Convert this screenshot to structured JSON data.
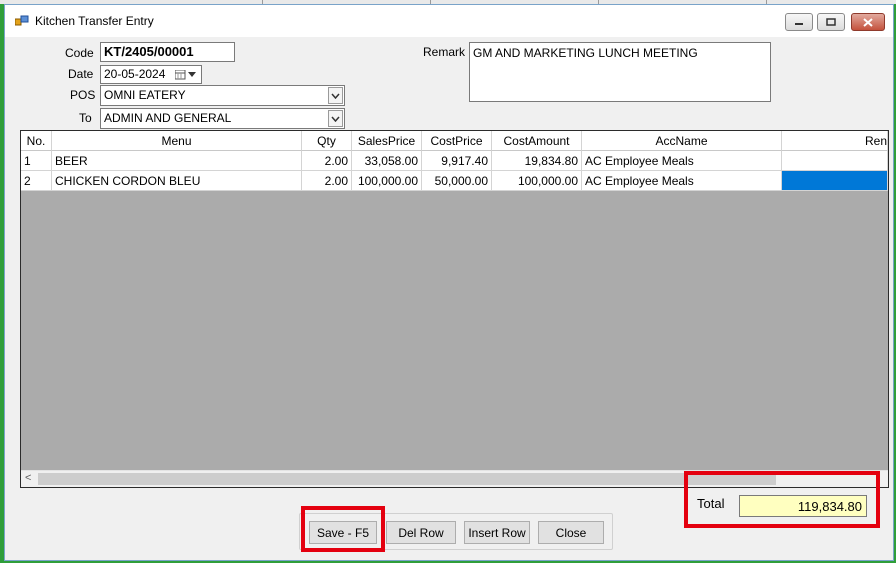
{
  "window": {
    "title": "Kitchen Transfer Entry"
  },
  "form": {
    "code_label": "Code",
    "code_value": "KT/2405/00001",
    "date_label": "Date",
    "date_value": "20-05-2024",
    "pos_label": "POS",
    "pos_value": "OMNI EATERY",
    "to_label": "To",
    "to_value": "ADMIN AND GENERAL",
    "remark_label": "Remark",
    "remark_value": "GM AND MARKETING LUNCH MEETING"
  },
  "grid": {
    "columns": [
      "No.",
      "Menu",
      "Qty",
      "SalesPrice",
      "CostPrice",
      "CostAmount",
      "AccName",
      "Ren"
    ],
    "rows": [
      {
        "no": "1",
        "menu": "BEER",
        "qty": "2.00",
        "sales_price": "33,058.00",
        "cost_price": "9,917.40",
        "cost_amount": "19,834.80",
        "acc_name": "AC Employee Meals",
        "ren": ""
      },
      {
        "no": "2",
        "menu": "CHICKEN CORDON BLEU",
        "qty": "2.00",
        "sales_price": "100,000.00",
        "cost_price": "50,000.00",
        "cost_amount": "100,000.00",
        "acc_name": "AC Employee Meals",
        "ren": ""
      }
    ],
    "scroll_left_arrow": "<"
  },
  "footer": {
    "total_label": "Total",
    "total_value": "119,834.80"
  },
  "buttons": {
    "save": "Save - F5",
    "del_row": "Del Row",
    "insert_row": "Insert Row",
    "close": "Close"
  },
  "colors": {
    "highlight": "#e4000f",
    "selection": "#0078d7",
    "total_bg": "#ffffc0"
  }
}
